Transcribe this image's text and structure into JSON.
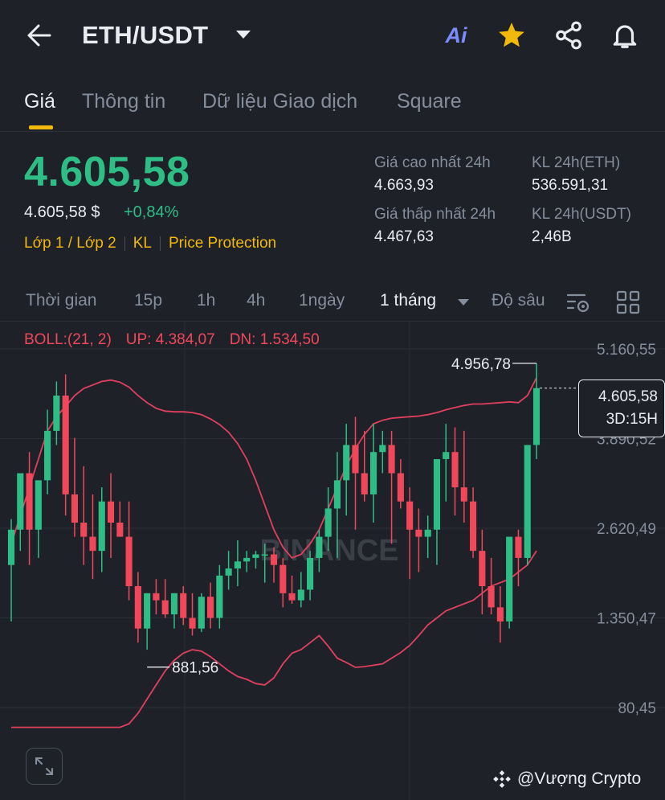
{
  "header": {
    "pair": "ETH/USDT",
    "ai_label": "Ai"
  },
  "tabs": [
    {
      "label": "Giá",
      "active": true
    },
    {
      "label": "Thông tin",
      "active": false
    },
    {
      "label": "Dữ liệu Giao dịch",
      "active": false
    },
    {
      "label": "Square",
      "active": false
    }
  ],
  "price": {
    "last": "4.605,58",
    "usd": "4.605,58 $",
    "change": "+0,84%",
    "tags": [
      "Lớp 1 / Lớp 2",
      "KL",
      "Price Protection"
    ]
  },
  "stats": {
    "high_label": "Giá cao nhất 24h",
    "high_value": "4.663,93",
    "low_label": "Giá thấp nhất 24h",
    "low_value": "4.467,63",
    "vol_eth_label": "KL 24h(ETH)",
    "vol_eth_value": "536.591,31",
    "vol_usdt_label": "KL 24h(USDT)",
    "vol_usdt_value": "2,46B"
  },
  "timeframes": {
    "items": [
      "Thời gian",
      "15p",
      "1h",
      "4h",
      "1ngày",
      "1 tháng",
      "Độ sâu"
    ],
    "active": "1 tháng"
  },
  "boll": {
    "label": "BOLL:(21, 2)",
    "up": "UP: 4.384,07",
    "dn": "DN: 1.534,50"
  },
  "chart_data": {
    "type": "candlestick",
    "y_ticks": [
      "5.160,55",
      "3.890,52",
      "2.620,49",
      "1.350,47",
      "80,45"
    ],
    "y_tick_values": [
      5160.55,
      3890.52,
      2620.49,
      1350.47,
      80.45
    ],
    "ylim": [
      -200,
      5500
    ],
    "max_label": "4.956,78",
    "max_value": 4956.78,
    "min_label": "881,56",
    "min_value": 881.56,
    "last_price_label": "4.605,58",
    "countdown": "3D:15H",
    "watermark": "BINANCE",
    "candles": [
      [
        2100,
        2750,
        1300,
        2600
      ],
      [
        2600,
        3000,
        2300,
        3400
      ],
      [
        3400,
        3700,
        2100,
        2600
      ],
      [
        2600,
        2800,
        2200,
        3300
      ],
      [
        3300,
        4300,
        3100,
        4000
      ],
      [
        4000,
        4700,
        3800,
        4500
      ],
      [
        4500,
        4800,
        2800,
        3100
      ],
      [
        3100,
        3900,
        2500,
        2700
      ],
      [
        2700,
        3500,
        2100,
        2500
      ],
      [
        2500,
        3100,
        1900,
        2300
      ],
      [
        2300,
        3200,
        2000,
        3000
      ],
      [
        3000,
        3400,
        2200,
        2700
      ],
      [
        2700,
        3000,
        2500,
        2500
      ],
      [
        2500,
        3000,
        1600,
        1800
      ],
      [
        1800,
        2000,
        1000,
        1200
      ],
      [
        1200,
        1700,
        900,
        1700
      ],
      [
        1700,
        1900,
        1400,
        1600
      ],
      [
        1600,
        1900,
        1350,
        1400
      ],
      [
        1400,
        1700,
        1200,
        1700
      ],
      [
        1700,
        1800,
        1250,
        1350
      ],
      [
        1350,
        1700,
        1100,
        1200
      ],
      [
        1200,
        1700,
        1150,
        1650
      ],
      [
        1650,
        1850,
        1200,
        1350
      ],
      [
        1350,
        2100,
        1200,
        1950
      ],
      [
        1950,
        2300,
        1750,
        2050
      ],
      [
        2050,
        2450,
        1800,
        2150
      ],
      [
        2150,
        2300,
        2000,
        2200
      ],
      [
        2200,
        2300,
        2050,
        2250
      ],
      [
        2250,
        2400,
        1850,
        2250
      ],
      [
        2250,
        2350,
        1850,
        2100
      ],
      [
        2100,
        2200,
        1500,
        1700
      ],
      [
        1700,
        1950,
        1550,
        1600
      ],
      [
        1600,
        2000,
        1500,
        1750
      ],
      [
        1750,
        2300,
        1600,
        2200
      ],
      [
        2200,
        2600,
        2000,
        2500
      ],
      [
        2500,
        3200,
        2300,
        2900
      ],
      [
        2900,
        3700,
        2200,
        3300
      ],
      [
        3300,
        4100,
        2800,
        3800
      ],
      [
        3800,
        4200,
        2600,
        3400
      ],
      [
        3400,
        4000,
        3000,
        3100
      ],
      [
        3100,
        4100,
        2700,
        3700
      ],
      [
        3700,
        4000,
        3400,
        3800
      ],
      [
        3800,
        4000,
        2400,
        3400
      ],
      [
        3400,
        3600,
        2900,
        3000
      ],
      [
        3000,
        3200,
        1900,
        2600
      ],
      [
        2600,
        2900,
        2000,
        2500
      ],
      [
        2500,
        2800,
        2200,
        2600
      ],
      [
        2600,
        3300,
        2100,
        3600
      ],
      [
        3600,
        4100,
        3000,
        3700
      ],
      [
        3700,
        4050,
        2800,
        3200
      ],
      [
        3200,
        4000,
        2700,
        3000
      ],
      [
        3000,
        3200,
        2200,
        2300
      ],
      [
        2300,
        2600,
        1400,
        1800
      ],
      [
        1800,
        2200,
        1400,
        1500
      ],
      [
        1500,
        1800,
        1000,
        1300
      ],
      [
        1300,
        2400,
        1200,
        2500
      ],
      [
        2500,
        2600,
        1800,
        2200
      ],
      [
        2200,
        3700,
        2100,
        3800
      ],
      [
        3800,
        4956.78,
        3600,
        4605.58
      ]
    ],
    "boll_mid": [
      2400,
      2800,
      3200,
      3600,
      4000,
      4200,
      4350,
      4500,
      4600,
      4650,
      4700,
      4720,
      4690,
      4620,
      4500,
      4400,
      4320,
      4280,
      4270,
      4270,
      4260,
      4230,
      4170,
      4090,
      3980,
      3820,
      3600,
      3300,
      2950,
      2600,
      2350,
      2200,
      2250,
      2400,
      2600,
      2900,
      3200,
      3500,
      3750,
      3950,
      4100,
      4150,
      4180,
      4190,
      4200,
      4210,
      4230,
      4260,
      4300,
      4330,
      4360,
      4380,
      4380,
      4390,
      4400,
      4410,
      4400,
      4500,
      4750
    ],
    "boll_lower": [
      -200,
      -200,
      -200,
      -200,
      -200,
      -200,
      -200,
      -200,
      -200,
      -200,
      -200,
      -200,
      -200,
      -150,
      0,
      200,
      400,
      600,
      750,
      850,
      900,
      880,
      800,
      700,
      600,
      520,
      480,
      420,
      400,
      500,
      700,
      850,
      900,
      1000,
      1100,
      950,
      780,
      720,
      650,
      660,
      680,
      700,
      780,
      860,
      960,
      1100,
      1250,
      1350,
      1450,
      1500,
      1550,
      1600,
      1700,
      1800,
      1850,
      1900,
      2000,
      2100,
      2300
    ]
  },
  "footer": {
    "watermark": "@Vượng Crypto"
  }
}
